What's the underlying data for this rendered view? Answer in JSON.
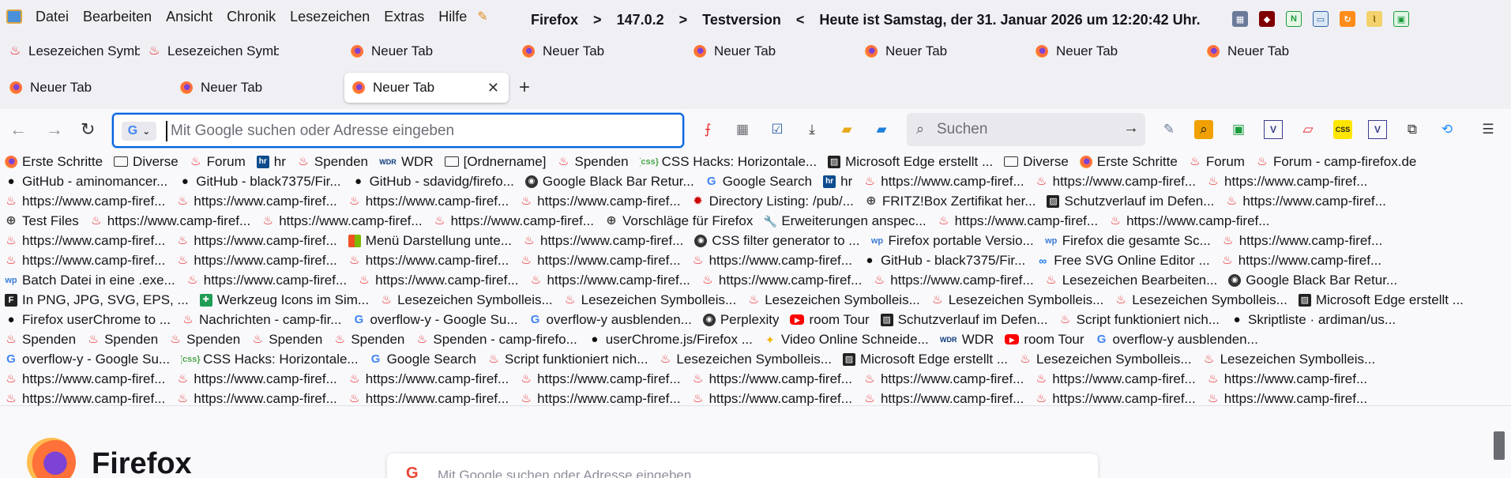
{
  "menu": {
    "items": [
      "Datei",
      "Bearbeiten",
      "Ansicht",
      "Chronik",
      "Lesezeichen",
      "Extras",
      "Hilfe"
    ]
  },
  "title": {
    "app": "Firefox",
    "sep1": ">",
    "version": "147.0.2",
    "sep2": ">",
    "channel": "Testversion",
    "sep3": "<",
    "date_text": "Heute ist Samstag, der 31. Januar 2026 um 12:20:42 Uhr."
  },
  "tabs_row1": [
    {
      "label": "Lesezeichen Symboll",
      "favicon": "flame-icon"
    },
    {
      "label": "Lesezeichen Symboll",
      "favicon": "flame-icon"
    },
    {
      "label": "Neuer Tab",
      "favicon": "firefox-icon"
    },
    {
      "label": "Neuer Tab",
      "favicon": "firefox-icon"
    },
    {
      "label": "Neuer Tab",
      "favicon": "firefox-icon"
    },
    {
      "label": "Neuer Tab",
      "favicon": "firefox-icon"
    },
    {
      "label": "Neuer Tab",
      "favicon": "firefox-icon"
    },
    {
      "label": "Neuer Tab",
      "favicon": "firefox-icon"
    }
  ],
  "tabs_row2": [
    {
      "label": "Neuer Tab",
      "favicon": "firefox-icon"
    },
    {
      "label": "Neuer Tab",
      "favicon": "firefox-icon"
    },
    {
      "label": "Neuer Tab",
      "favicon": "firefox-icon",
      "active": true
    }
  ],
  "tab_close": "✕",
  "new_tab": "+",
  "urlbar": {
    "engine": "G",
    "placeholder": "Mit Google suchen oder Adresse eingeben",
    "value": ""
  },
  "searchbar": {
    "placeholder": "Suchen"
  },
  "bookmarks": [
    [
      [
        "folder",
        "Erste Schritte",
        "ff"
      ],
      [
        "folder",
        "Diverse",
        "folder"
      ],
      [
        "f",
        "Forum",
        "flame"
      ],
      [
        "hr",
        "hr",
        "hr"
      ],
      [
        "f",
        "Spenden",
        "flame"
      ],
      [
        "wdr",
        "WDR",
        "wdr"
      ],
      [
        "folder",
        "[Ordnername]",
        "folder"
      ],
      [
        "f",
        "Spenden",
        "flame"
      ],
      [
        "css",
        "CSS Hacks: Horizontale...",
        "css"
      ],
      [
        "edge",
        "Microsoft Edge erstellt ...",
        "edge"
      ],
      [
        "folder",
        "Diverse",
        "folder"
      ],
      [
        "ff",
        "Erste Schritte",
        "ff"
      ],
      [
        "f",
        "Forum",
        "flame"
      ],
      [
        "f",
        "Forum - camp-firefox.de",
        "flame"
      ]
    ],
    [
      [
        "gh",
        "GitHub - aminomancer...",
        "gh"
      ],
      [
        "gh",
        "GitHub - black7375/Fir...",
        "gh"
      ],
      [
        "gh",
        "GitHub - sdavidg/firefo...",
        "gh"
      ],
      [
        "gen",
        "Google Black Bar Retur...",
        "gen"
      ],
      [
        "g",
        "Google Search",
        "google"
      ],
      [
        "hr",
        "hr",
        "hr"
      ],
      [
        "f",
        "https://www.camp-firef...",
        "flame"
      ],
      [
        "f",
        "https://www.camp-firef...",
        "flame"
      ],
      [
        "f",
        "https://www.camp-firef...",
        "flame"
      ]
    ],
    [
      [
        "f",
        "https://www.camp-firef...",
        "flame"
      ],
      [
        "f",
        "https://www.camp-firef...",
        "flame"
      ],
      [
        "f",
        "https://www.camp-firef...",
        "flame"
      ],
      [
        "f",
        "https://www.camp-firef...",
        "flame"
      ],
      [
        "bug",
        "Directory Listing: /pub/...",
        "bug"
      ],
      [
        "globe",
        "FRITZ!Box Zertifikat her...",
        "globe"
      ],
      [
        "edge",
        "Schutzverlauf im Defen...",
        "edge"
      ],
      [
        "f",
        "https://www.camp-firef...",
        "flame"
      ]
    ],
    [
      [
        "globe",
        "Test Files",
        "globe"
      ],
      [
        "f",
        "https://www.camp-firef...",
        "flame"
      ],
      [
        "f",
        "https://www.camp-firef...",
        "flame"
      ],
      [
        "f",
        "https://www.camp-firef...",
        "flame"
      ],
      [
        "globe",
        "Vorschläge für Firefox",
        "globe"
      ],
      [
        "wrench",
        "Erweiterungen anspec...",
        "wrench"
      ],
      [
        "f",
        "https://www.camp-firef...",
        "flame"
      ],
      [
        "f",
        "https://www.camp-firef...",
        "flame"
      ]
    ],
    [
      [
        "f",
        "https://www.camp-firef...",
        "flame"
      ],
      [
        "f",
        "https://www.camp-firef...",
        "flame"
      ],
      [
        "ms",
        "Menü Darstellung unte...",
        "ms"
      ],
      [
        "f",
        "https://www.camp-firef...",
        "flame"
      ],
      [
        "gen",
        "CSS filter generator to ...",
        "gen"
      ],
      [
        "wp",
        "Firefox portable Versio...",
        "wp"
      ],
      [
        "wp",
        "Firefox die gesamte Sc...",
        "wp"
      ],
      [
        "f",
        "https://www.camp-firef...",
        "flame"
      ]
    ],
    [
      [
        "f",
        "https://www.camp-firef...",
        "flame"
      ],
      [
        "f",
        "https://www.camp-firef...",
        "flame"
      ],
      [
        "f",
        "https://www.camp-firef...",
        "flame"
      ],
      [
        "f",
        "https://www.camp-firef...",
        "flame"
      ],
      [
        "f",
        "https://www.camp-firef...",
        "flame"
      ],
      [
        "gh",
        "GitHub - black7375/Fir...",
        "gh"
      ],
      [
        "meta",
        "Free SVG Online Editor ...",
        "meta"
      ],
      [
        "f",
        "https://www.camp-firef...",
        "flame"
      ]
    ],
    [
      [
        "wp",
        "Batch Datei in eine .exe...",
        "wp"
      ],
      [
        "f",
        "https://www.camp-firef...",
        "flame"
      ],
      [
        "f",
        "https://www.camp-firef...",
        "flame"
      ],
      [
        "f",
        "https://www.camp-firef...",
        "flame"
      ],
      [
        "f",
        "https://www.camp-firef...",
        "flame"
      ],
      [
        "f",
        "https://www.camp-firef...",
        "flame"
      ],
      [
        "f",
        "Lesezeichen Bearbeiten...",
        "flame"
      ],
      [
        "gen",
        "Google Black Bar Retur...",
        "gen"
      ]
    ],
    [
      [
        "fonts",
        "In PNG, JPG, SVG, EPS, ...",
        "fonts"
      ],
      [
        "green",
        "Werkzeug Icons im Sim...",
        "green"
      ],
      [
        "f",
        "Lesezeichen Symbolleis...",
        "flame"
      ],
      [
        "f",
        "Lesezeichen Symbolleis...",
        "flame"
      ],
      [
        "f",
        "Lesezeichen Symbolleis...",
        "flame"
      ],
      [
        "f",
        "Lesezeichen Symbolleis...",
        "flame"
      ],
      [
        "f",
        "Lesezeichen Symbolleis...",
        "flame"
      ],
      [
        "edge",
        "Microsoft Edge erstellt ...",
        "edge"
      ]
    ],
    [
      [
        "gh",
        "Firefox userChrome to ...",
        "gh"
      ],
      [
        "f",
        "Nachrichten - camp-fir...",
        "flame"
      ],
      [
        "g",
        "overflow-y - Google Su...",
        "google"
      ],
      [
        "g",
        "overflow-y ausblenden...",
        "google"
      ],
      [
        "gen",
        "Perplexity",
        "gen"
      ],
      [
        "yt",
        "room Tour",
        "yt"
      ],
      [
        "edge",
        "Schutzverlauf im Defen...",
        "edge"
      ],
      [
        "f",
        "Script funktioniert nich...",
        "flame"
      ],
      [
        "gh",
        "Skriptliste · ardiman/us...",
        "gh"
      ]
    ],
    [
      [
        "f",
        "Spenden",
        "flame"
      ],
      [
        "f",
        "Spenden",
        "flame"
      ],
      [
        "f",
        "Spenden",
        "flame"
      ],
      [
        "f",
        "Spenden",
        "flame"
      ],
      [
        "f",
        "Spenden",
        "flame"
      ],
      [
        "f",
        "Spenden - camp-firefo...",
        "flame"
      ],
      [
        "gh",
        "userChrome.js/Firefox ...",
        "gh"
      ],
      [
        "vid",
        "Video Online Schneide...",
        "vid"
      ],
      [
        "wdr",
        "WDR",
        "wdr"
      ],
      [
        "yt",
        "room Tour",
        "yt"
      ],
      [
        "g",
        "overflow-y ausblenden...",
        "google"
      ]
    ],
    [
      [
        "g",
        "overflow-y - Google Su...",
        "google"
      ],
      [
        "css",
        "CSS Hacks: Horizontale...",
        "css"
      ],
      [
        "g",
        "Google Search",
        "google"
      ],
      [
        "f",
        "Script funktioniert nich...",
        "flame"
      ],
      [
        "f",
        "Lesezeichen Symbolleis...",
        "flame"
      ],
      [
        "edge",
        "Microsoft Edge erstellt ...",
        "edge"
      ],
      [
        "f",
        "Lesezeichen Symbolleis...",
        "flame"
      ],
      [
        "f",
        "Lesezeichen Symbolleis...",
        "flame"
      ]
    ],
    [
      [
        "f",
        "https://www.camp-firef...",
        "flame"
      ],
      [
        "f",
        "https://www.camp-firef...",
        "flame"
      ],
      [
        "f",
        "https://www.camp-firef...",
        "flame"
      ],
      [
        "f",
        "https://www.camp-firef...",
        "flame"
      ],
      [
        "f",
        "https://www.camp-firef...",
        "flame"
      ],
      [
        "f",
        "https://www.camp-firef...",
        "flame"
      ],
      [
        "f",
        "https://www.camp-firef...",
        "flame"
      ],
      [
        "f",
        "https://www.camp-firef...",
        "flame"
      ]
    ],
    [
      [
        "f",
        "https://www.camp-firef...",
        "flame"
      ],
      [
        "f",
        "https://www.camp-firef...",
        "flame"
      ],
      [
        "f",
        "https://www.camp-firef...",
        "flame"
      ],
      [
        "f",
        "https://www.camp-firef...",
        "flame"
      ],
      [
        "f",
        "https://www.camp-firef...",
        "flame"
      ],
      [
        "f",
        "https://www.camp-firef...",
        "flame"
      ],
      [
        "f",
        "https://www.camp-firef...",
        "flame"
      ],
      [
        "f",
        "https://www.camp-firef...",
        "flame"
      ]
    ]
  ],
  "newtab": {
    "wordmark": "Firefox",
    "search_engine": "G",
    "search_placeholder": "Mit Google suchen oder Adresse eingeben"
  },
  "colors": {
    "accent": "#0061e0",
    "flame": "#e8292b"
  }
}
